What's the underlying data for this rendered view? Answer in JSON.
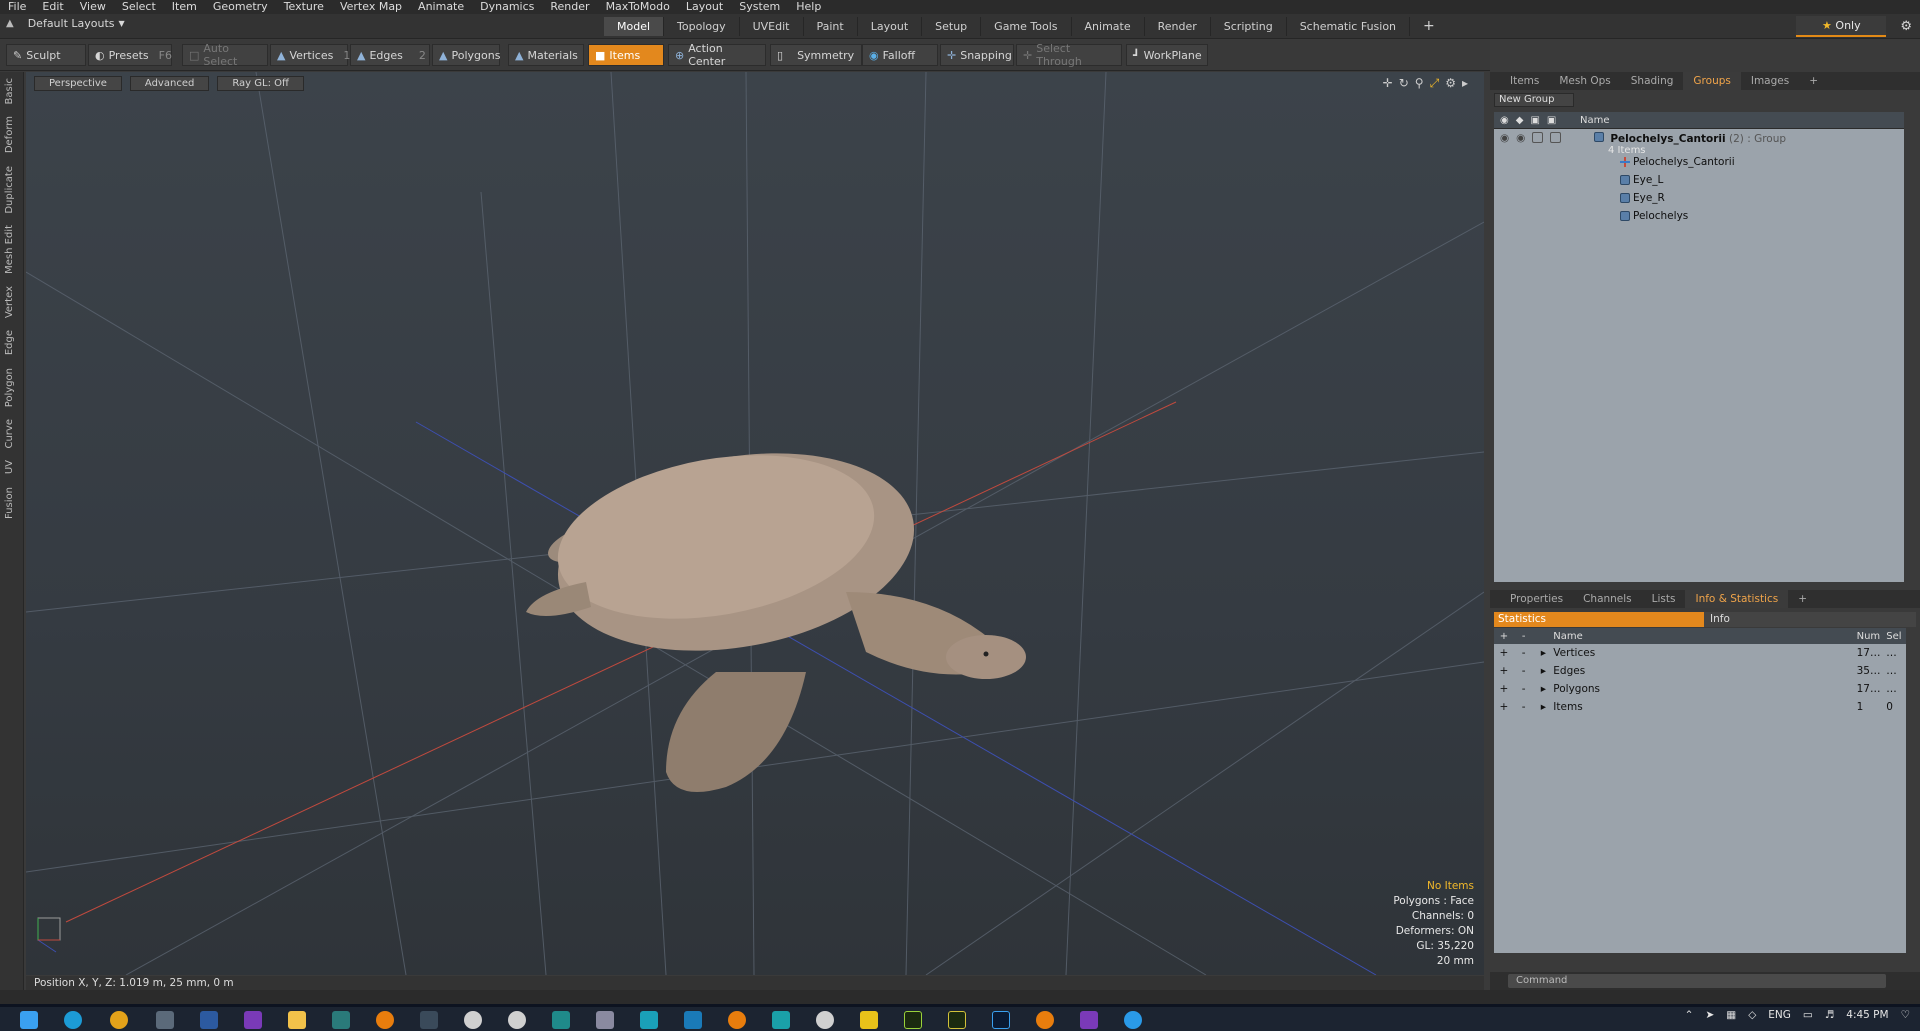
{
  "menu": [
    "File",
    "Edit",
    "View",
    "Select",
    "Item",
    "Geometry",
    "Texture",
    "Vertex Map",
    "Animate",
    "Dynamics",
    "Render",
    "MaxToModo",
    "Layout",
    "System",
    "Help"
  ],
  "layout_selector": "Default Layouts",
  "layout_tabs": [
    {
      "label": "Model",
      "active": true
    },
    {
      "label": "Topology",
      "active": false
    },
    {
      "label": "UVEdit",
      "active": false
    },
    {
      "label": "Paint",
      "active": false
    },
    {
      "label": "Layout",
      "active": false
    },
    {
      "label": "Setup",
      "active": false
    },
    {
      "label": "Game Tools",
      "active": false
    },
    {
      "label": "Animate",
      "active": false
    },
    {
      "label": "Render",
      "active": false
    },
    {
      "label": "Scripting",
      "active": false
    },
    {
      "label": "Schematic Fusion",
      "active": false
    }
  ],
  "only_label": "Only",
  "toolbar": {
    "sculpt": "Sculpt",
    "presets": "Presets",
    "presets_key": "F6",
    "auto_select": "Auto Select",
    "vertices": "Vertices",
    "vertices_key": "1",
    "edges": "Edges",
    "edges_key": "2",
    "polygons": "Polygons",
    "materials": "Materials",
    "items": "Items",
    "action_center": "Action Center",
    "symmetry": "Symmetry",
    "falloff": "Falloff",
    "snapping": "Snapping",
    "select_through": "Select Through",
    "workplane": "WorkPlane"
  },
  "left_tabs": [
    "Basic",
    "Deform",
    "Duplicate",
    "Mesh Edit",
    "Vertex",
    "Edge",
    "Polygon",
    "Curve",
    "UV",
    "Fusion"
  ],
  "viewport": {
    "view": "Perspective",
    "mode": "Advanced",
    "raygl": "Ray GL: Off",
    "stats": {
      "no_items": "No Items",
      "polygons": "Polygons : Face",
      "channels": "Channels: 0",
      "deformers": "Deformers: ON",
      "gl": "GL: 35,220",
      "scale": "20 mm"
    }
  },
  "statusbar": "Position X, Y, Z:  1.019 m, 25 mm, 0 m",
  "groups_panel": {
    "tabs": [
      {
        "label": "Items",
        "active": false
      },
      {
        "label": "Mesh Ops",
        "active": false
      },
      {
        "label": "Shading",
        "active": false
      },
      {
        "label": "Groups",
        "active": true
      },
      {
        "label": "Images",
        "active": false
      }
    ],
    "new_group": "New Group",
    "name_header": "Name",
    "group": {
      "name": "Pelochelys_Cantorii",
      "count": "(2)",
      "type": ": Group",
      "items_count": "4 Items"
    },
    "children": [
      "Pelochelys_Cantorii",
      "Eye_L",
      "Eye_R",
      "Pelochelys"
    ]
  },
  "stats_panel": {
    "tabs": [
      {
        "label": "Properties",
        "active": false
      },
      {
        "label": "Channels",
        "active": false
      },
      {
        "label": "Lists",
        "active": false
      },
      {
        "label": "Info & Statistics",
        "active": true
      }
    ],
    "statistics_label": "Statistics",
    "info_label": "Info",
    "headers": {
      "name": "Name",
      "num": "Num",
      "sel": "Sel"
    },
    "rows": [
      {
        "name": "Vertices",
        "num": "17…",
        "sel": "…"
      },
      {
        "name": "Edges",
        "num": "35…",
        "sel": "…"
      },
      {
        "name": "Polygons",
        "num": "17…",
        "sel": "…"
      },
      {
        "name": "Items",
        "num": "1",
        "sel": "0"
      }
    ]
  },
  "command_placeholder": "Command",
  "taskbar": {
    "lang": "ENG",
    "time": "4:45 PM"
  },
  "colors": {
    "accent": "#e3881d",
    "panel_list": "#9ba3ab"
  }
}
